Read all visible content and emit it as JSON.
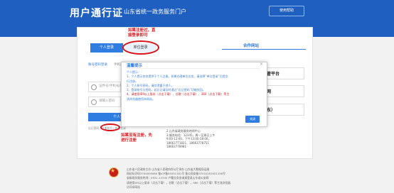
{
  "header": {
    "title": "用户通行证",
    "subtitle": "山东省统一政务服务门户",
    "help_button": "使用帮助"
  },
  "tabs": {
    "personal": "个人登录",
    "org": "单位登录"
  },
  "annotations": {
    "org_hint": [
      "如果注册过，直",
      "接登录即可"
    ],
    "register_hint": [
      "如果没有注册，先",
      "进行注册"
    ]
  },
  "login": {
    "subtab_account": "账号密码登录",
    "subtab_other": "手机验证码",
    "field_account_placeholder": "证件号/手机号/账",
    "field_password_placeholder": "请输入密码",
    "submit": "个人登录",
    "links": "忘记密码 | 注册账号 | 账号登录"
  },
  "cooperation": {
    "heading": "合作网站",
    "items": [
      "省市场监管平台",
      "业务服务网",
      "济南（山东）"
    ]
  },
  "modal": {
    "title": "温馨提示",
    "close": "×",
    "lines": [
      "个人提示：",
      "1、个人提示仅仅提供于个人注册。如果办理单位业务，请选择“单位登录”后提交",
      "行注册。",
      "2、个人账号密码，请勿泄露于他人。",
      "3、登录账号与密码，若忘记请及时通过“忘记密码”功能找回。",
      "4、请使用IE9以上版本（点击下载）、谷歌（点击下载）、360（点击下载）等主",
      "流浏览器使用本网站。"
    ],
    "ok_button": "关闭"
  },
  "contact": {
    "lines": [
      "2.山东省政务服务热线中心",
      "3.服务电话：12345，周一至周日上午",
      "9:00-12:00，下午13:00-18:00，",
      "18663771821、18663778751",
      "18663778981"
    ]
  },
  "footer": {
    "lines": [
      "山东省人民政府主办  山东省人民政府办公厅承办  山东省大数据局运维",
      "网站标识码3700000060  鲁ICP备05051181号  鲁公网安备37010202001156号",
      "省级政务服务热线：0531-12345  户籍业务咨询请登录山东省公安网",
      "请使用IE9以上版本（点击下载），谷歌（点击下载），360（点击下载）等主流浏览器",
      "访问本网站"
    ]
  },
  "colors": {
    "brand_blue": "#1e5fbf",
    "accent_blue": "#2f7de1",
    "annotation_red": "#d8141a"
  }
}
